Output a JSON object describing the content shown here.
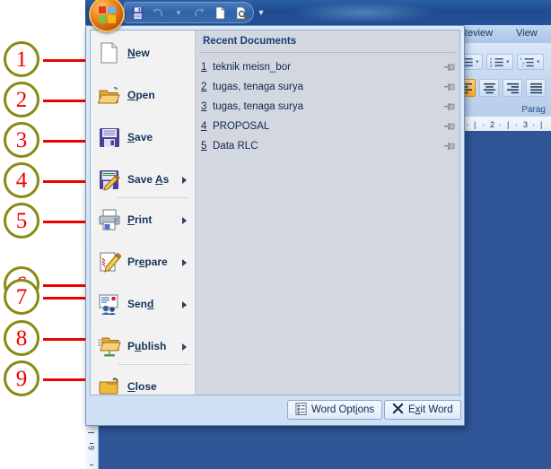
{
  "app": {
    "title_bar": {
      "glow": true
    },
    "office_button": {
      "name": "Office Button",
      "tooltip": "Office Button"
    },
    "quick_access": [
      {
        "id": "save",
        "label": "Save",
        "icon": "floppy-disk-icon",
        "enabled": true
      },
      {
        "id": "undo",
        "label": "Undo",
        "icon": "undo-arrow-icon",
        "enabled": false
      },
      {
        "id": "undo-dropdown",
        "label": "Undo options",
        "icon": "chevron-down-icon",
        "enabled": false
      },
      {
        "id": "redo",
        "label": "Redo",
        "icon": "redo-arrow-icon",
        "enabled": false
      },
      {
        "id": "new",
        "label": "New",
        "icon": "page-icon",
        "enabled": true
      },
      {
        "id": "print-preview",
        "label": "Print Preview",
        "icon": "print-preview-icon",
        "enabled": true
      }
    ],
    "qat_customize": {
      "label": "Customize Quick Access Toolbar",
      "icon": "chevron-down-icon"
    }
  },
  "ribbon": {
    "tabs": [
      {
        "id": "review",
        "label": "Review",
        "active": false
      },
      {
        "id": "view",
        "label": "View",
        "active": false
      }
    ],
    "group_label": "Parag",
    "list_buttons": [
      {
        "id": "bullets",
        "label": "Bullets",
        "icon": "bullet-list-icon"
      },
      {
        "id": "numbering",
        "label": "Numbering",
        "icon": "numbered-list-icon"
      },
      {
        "id": "multilevel",
        "label": "Multilevel List",
        "icon": "multilevel-list-icon"
      }
    ],
    "align_buttons": [
      {
        "id": "align-left",
        "label": "Align Text Left",
        "icon": "align-left-icon",
        "active": true
      },
      {
        "id": "align-center",
        "label": "Center",
        "icon": "align-center-icon",
        "active": false
      },
      {
        "id": "align-right",
        "label": "Align Text Right",
        "icon": "align-right-icon",
        "active": false
      },
      {
        "id": "justify",
        "label": "Justify",
        "icon": "align-justify-icon",
        "active": false
      }
    ]
  },
  "rulers": {
    "horizontal_ticks": [
      "2",
      "3"
    ],
    "vertical_ticks": [
      "6"
    ]
  },
  "office_menu": {
    "items": [
      {
        "id": "new",
        "label_pre": "",
        "label_key": "N",
        "label_post": "ew",
        "icon": "new-document-icon",
        "submenu": false,
        "separator_after": false
      },
      {
        "id": "open",
        "label_pre": "",
        "label_key": "O",
        "label_post": "pen",
        "icon": "open-folder-icon",
        "submenu": false,
        "separator_after": false
      },
      {
        "id": "save",
        "label_pre": "",
        "label_key": "S",
        "label_post": "ave",
        "icon": "save-floppy-icon",
        "submenu": false,
        "separator_after": false
      },
      {
        "id": "save-as",
        "label_pre": "Save ",
        "label_key": "A",
        "label_post": "s",
        "icon": "save-as-icon",
        "submenu": true,
        "separator_after": true
      },
      {
        "id": "print",
        "label_pre": "",
        "label_key": "P",
        "label_post": "rint",
        "icon": "printer-icon",
        "submenu": true,
        "separator_after": false
      },
      {
        "id": "prepare",
        "label_pre": "Pr",
        "label_key": "e",
        "label_post": "pare",
        "icon": "prepare-icon",
        "submenu": true,
        "separator_after": false
      },
      {
        "id": "send",
        "label_pre": "Sen",
        "label_key": "d",
        "label_post": "",
        "icon": "send-icon",
        "submenu": true,
        "separator_after": false
      },
      {
        "id": "publish",
        "label_pre": "P",
        "label_key": "u",
        "label_post": "blish",
        "icon": "publish-icon",
        "submenu": true,
        "separator_after": true
      },
      {
        "id": "close",
        "label_pre": "",
        "label_key": "C",
        "label_post": "lose",
        "icon": "close-folder-icon",
        "submenu": false,
        "separator_after": false
      }
    ],
    "recent": {
      "title": "Recent Documents",
      "documents": [
        {
          "num": "1",
          "name": "teknik meisn_bor",
          "pinned": false,
          "pin_icon": "pushpin-icon"
        },
        {
          "num": "2",
          "name": "tugas, tenaga surya",
          "pinned": false,
          "pin_icon": "pushpin-icon"
        },
        {
          "num": "3",
          "name": "tugas, tenaga surya",
          "pinned": false,
          "pin_icon": "pushpin-icon"
        },
        {
          "num": "4",
          "name": "PROPOSAL",
          "pinned": false,
          "pin_icon": "pushpin-icon"
        },
        {
          "num": "5",
          "name": "Data RLC",
          "pinned": false,
          "pin_icon": "pushpin-icon"
        }
      ]
    },
    "footer": {
      "word_options": {
        "label_pre": "Word Opt",
        "label_key": "i",
        "label_post": "ons",
        "icon": "word-options-icon"
      },
      "exit_word": {
        "label_pre": "E",
        "label_key": "x",
        "label_post": "it Word",
        "icon": "close-x-icon"
      }
    }
  },
  "callouts": [
    {
      "number": "1",
      "target": "new"
    },
    {
      "number": "2",
      "target": "open"
    },
    {
      "number": "3",
      "target": "save"
    },
    {
      "number": "4",
      "target": "save-as"
    },
    {
      "number": "5",
      "target": "print"
    },
    {
      "number": "6",
      "target": "prepare"
    },
    {
      "number": "7",
      "target": "send"
    },
    {
      "number": "8",
      "target": "publish"
    },
    {
      "number": "9",
      "target": "close"
    }
  ],
  "colors": {
    "callout_circle_border": "#8a8a12",
    "callout_number": "#ee0000",
    "arrow": "#ee0000",
    "title_bar": "#1f4c8c",
    "menu_left_panel": "#f2f2f2",
    "menu_right_panel": "#d2d7e0",
    "document_background": "#2f5596",
    "accent_highlight": "#f5a623"
  }
}
